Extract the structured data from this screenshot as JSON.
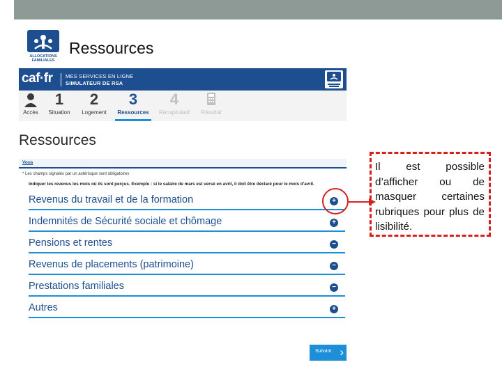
{
  "slide": {
    "title": "Ressources",
    "logo_icon": "caf-allocations-familiales-logo"
  },
  "app": {
    "brand": "caf·fr",
    "header_line1": "MES SERVICES EN LIGNE",
    "header_line2": "SIMULATEUR DE RSA",
    "header_logo_icon": "caf-logo",
    "header_color": "#1d4e8f"
  },
  "steps": [
    {
      "num": "",
      "label": "Accès",
      "icon": "person-icon",
      "state": "done"
    },
    {
      "num": "1",
      "label": "Situation",
      "state": "done"
    },
    {
      "num": "2",
      "label": "Logement",
      "state": "done"
    },
    {
      "num": "3",
      "label": "Ressources",
      "state": "active"
    },
    {
      "num": "4",
      "label": "Récapitulatif",
      "state": "disabled"
    },
    {
      "num": "",
      "label": "Résultat",
      "icon": "calculator-icon",
      "state": "disabled"
    }
  ],
  "page": {
    "heading": "Ressources",
    "tab_label": "Vous",
    "mandatory_note": "* Les champs signalés par un astérisque sont obligatoires",
    "instruction": "Indiquer les revenus les mois où ils sont perçus. Exemple : si le salaire de mars est versé en avril, il doit être déclaré pour le mois d'avril."
  },
  "sections": [
    {
      "label": "Revenus du travail et de la formation",
      "toggle": "+"
    },
    {
      "label": "Indemnités de Sécurité sociale et chômage",
      "toggle": "+"
    },
    {
      "label": "Pensions et rentes",
      "toggle": "−"
    },
    {
      "label": "Revenus de placements (patrimoine)",
      "toggle": "−"
    },
    {
      "label": "Prestations familiales",
      "toggle": "−"
    },
    {
      "label": "Autres",
      "toggle": "+"
    }
  ],
  "next_button": {
    "label": "Suivant",
    "icon": "chevron-right-icon"
  },
  "callout": {
    "text": "Il est possible d’afficher ou de masquer certaines rubriques pour plus de lisibilité.",
    "color": "#d42020"
  },
  "colors": {
    "accent": "#1d8fd8",
    "brand": "#1d4e8f",
    "annotation": "#d42020"
  }
}
